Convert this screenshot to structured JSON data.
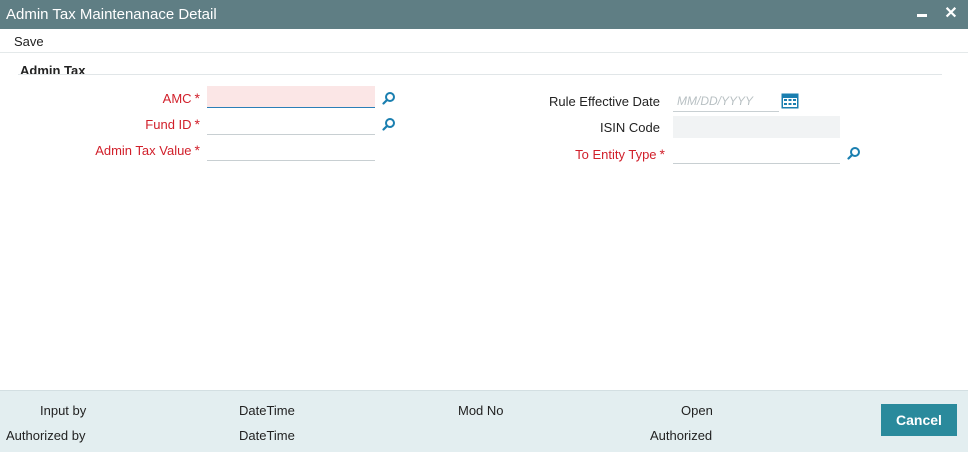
{
  "window": {
    "title": "Admin Tax Maintenanace Detail"
  },
  "toolbar": {
    "save_label": "Save"
  },
  "section": {
    "title": "Admin Tax"
  },
  "form": {
    "amc_label": "AMC",
    "fund_id_label": "Fund ID",
    "admin_tax_value_label": "Admin Tax Value",
    "rule_effective_date_label": "Rule Effective Date",
    "rule_effective_date_placeholder": "MM/DD/YYYY",
    "isin_code_label": "ISIN Code",
    "to_entity_type_label": "To Entity Type",
    "required_mark": "*"
  },
  "footer": {
    "input_by": "Input by",
    "authorized_by": "Authorized by",
    "datetime_1": "DateTime",
    "datetime_2": "DateTime",
    "mod_no": "Mod No",
    "open": "Open",
    "authorized": "Authorized",
    "cancel_label": "Cancel"
  },
  "colors": {
    "titlebar": "#5f7e84",
    "required": "#d11f2a",
    "accent": "#2a8a9c",
    "footer_bg": "#e3eef0"
  }
}
